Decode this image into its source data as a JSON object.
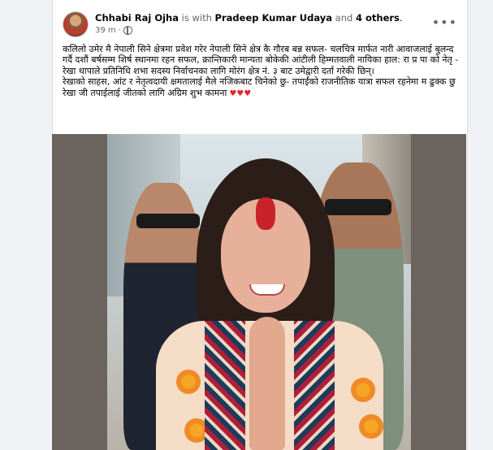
{
  "post": {
    "author": "Chhabi Raj Ojha",
    "with_text": " is with ",
    "tagged": "Pradeep Kumar Udaya",
    "and_text": " and ",
    "others": "4 others",
    "period": ".",
    "time": "39 m",
    "privacy_icon": "globe-icon",
    "more_icon": "more-icon",
    "more_label": "•••",
    "paragraphs": [
      "कलिलो उमेर मै नेपाली सिने क्षेत्रमा प्रवेश गरेर नेपाली सिने क्षेत्र कै गौरब बन्न सफल- चलचित्र मार्फत नारी आवाजलाई बुलन्द गर्दै दशौं बर्षसम्म शिर्ष स्थानमा रहन सफल, क्रान्तिकारी मान्यता बोकेकी आंटीली हिम्मतवाली नायिका हाल: रा प्र पा को नेतृ - रेखा थापाले प्रतिनिधि शभा सदस्य निर्वाचनका लागि मोरंग क्षेत्र नं. ३ बाट उमेद्वारी दर्ता गरेकी छिन्।",
      "रेखाको साहस, आंट र नेतृत्वदायी क्षमतालाई मैले नजिकबाट चिनेको छु- तपाईंको राजनीतिक यात्रा सफल रहनेमा म ढुक्क छु",
      "रेखा जी तपाईलाई जीतको लागि अग्रिम शुभ कामना"
    ],
    "hearts": "♥♥♥",
    "photo_alt": "Smiling woman with red tika and namaste gesture, flanked by two men in sunglasses"
  },
  "colors": {
    "page_bg": "#f0f2f5",
    "card_bg": "#ffffff",
    "text": "#050505",
    "muted": "#65676b",
    "heart": "#e4252a",
    "photo_frame": "#6b635d"
  }
}
